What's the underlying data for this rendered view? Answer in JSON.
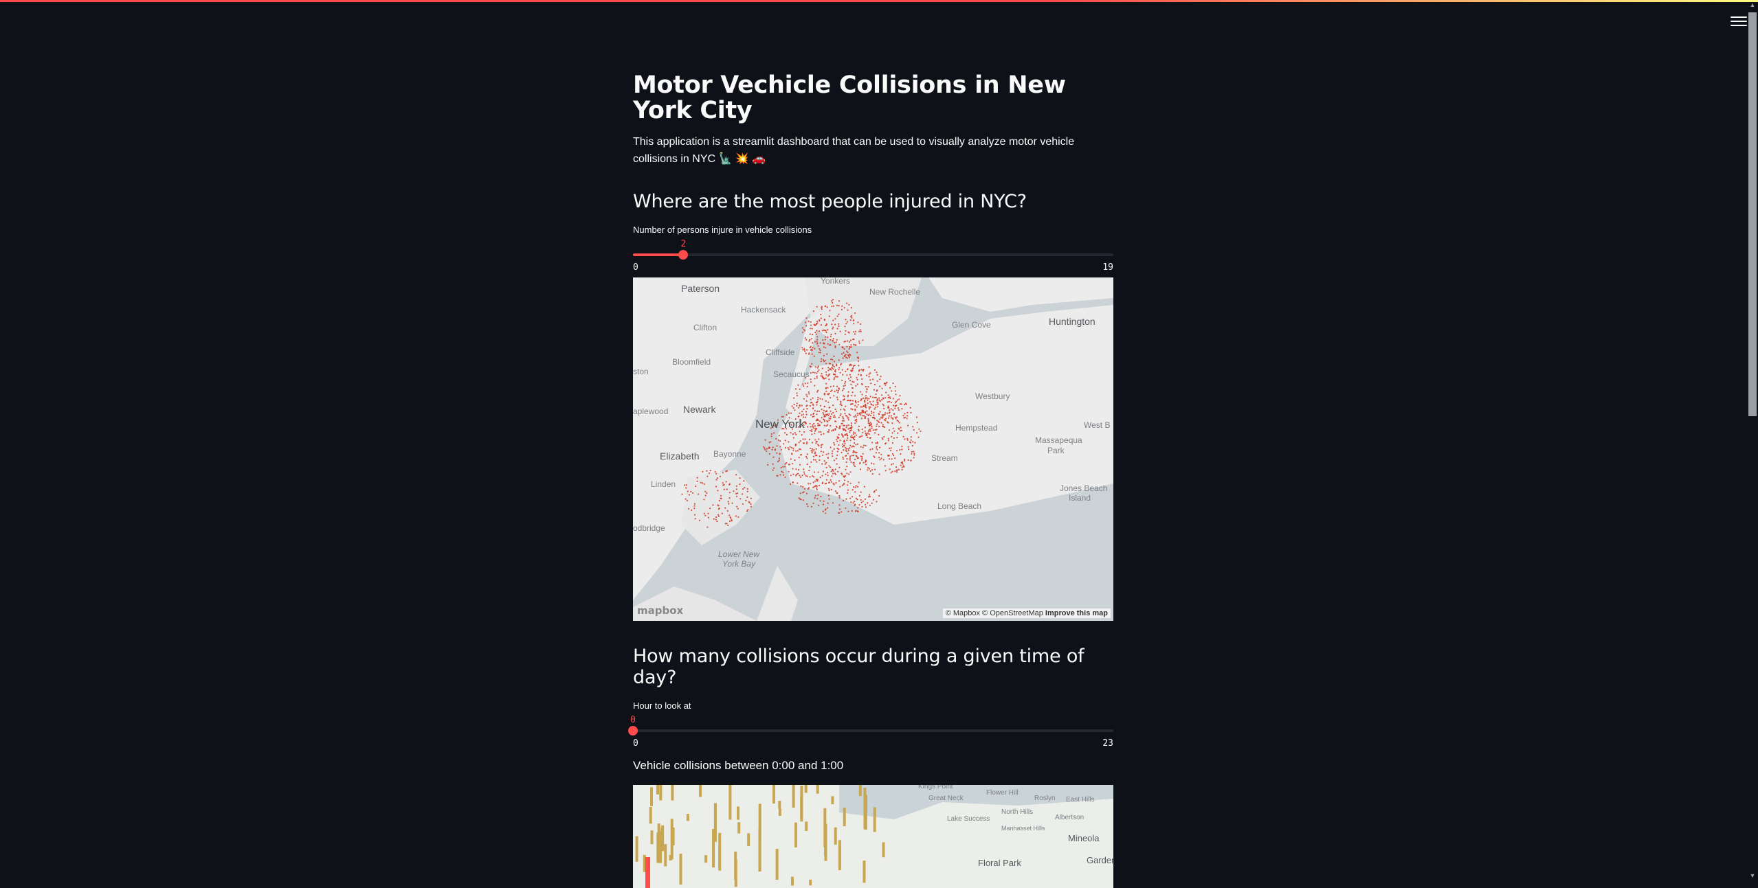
{
  "app": {
    "title": "Motor Vechicle Collisions in New York City",
    "description": "This application is a streamlit dashboard that can be used to visually analyze motor vehicle collisions in NYC 🗽 💥 🚗"
  },
  "section1": {
    "heading": "Where are the most people injured in NYC?",
    "slider": {
      "label": "Number of persons injure in vehicle collisions",
      "value": "2",
      "min": "0",
      "max": "19",
      "fraction": 0.105
    }
  },
  "map1": {
    "labels": {
      "yonkers": "Yonkers",
      "paterson": "Paterson",
      "new_rochelle": "New Rochelle",
      "hackensack": "Hackensack",
      "glen_cove": "Glen Cove",
      "huntington": "Huntington",
      "clifton": "Clifton",
      "cliffside": "Cliffside",
      "bloomfield": "Bloomfield",
      "ston": "ston",
      "secaucus": "Secaucus",
      "westbury": "Westbury",
      "newark": "Newark",
      "aplewood": "aplewood",
      "new_york": "New York",
      "hempstead": "Hempstead",
      "west_b": "West B",
      "massapequa": "Massapequa",
      "park": "Park",
      "elizabeth": "Elizabeth",
      "bayonne": "Bayonne",
      "stream": "Stream",
      "linden": "Linden",
      "long_beach": "Long Beach",
      "jones_beach": "Jones Beach",
      "island": "Island",
      "odbridge": "odbridge",
      "lower_ny_bay_1": "Lower New",
      "lower_ny_bay_2": "York Bay"
    },
    "logo": "mapbox",
    "attribution_prefix": "© Mapbox © OpenStreetMap",
    "attribution_link": "Improve this map"
  },
  "section2": {
    "heading": "How many collisions occur during a given time of day?",
    "slider": {
      "label": "Hour to look at",
      "value": "0",
      "min": "0",
      "max": "23",
      "fraction": 0.0
    },
    "subheading": "Vehicle collisions between 0:00 and 1:00"
  },
  "map2": {
    "labels": {
      "kings_point": "Kings Point",
      "great_neck": "Great Neck",
      "flower_hill": "Flower Hill",
      "roslyn": "Roslyn",
      "east_hills": "East Hills",
      "north_hills": "North Hills",
      "lake_success": "Lake Success",
      "manhasset_hills": "Manhasset Hills",
      "albertson": "Albertson",
      "mineola": "Mineola",
      "floral_park": "Floral Park",
      "garden": "Garden"
    }
  },
  "colors": {
    "accent": "#ff4b4b",
    "background": "#0e1117",
    "text": "#fafafa",
    "collision_dot": "#d0321e",
    "bar_column": "#c9a650"
  },
  "icons": {
    "menu": "hamburger-menu-icon"
  }
}
